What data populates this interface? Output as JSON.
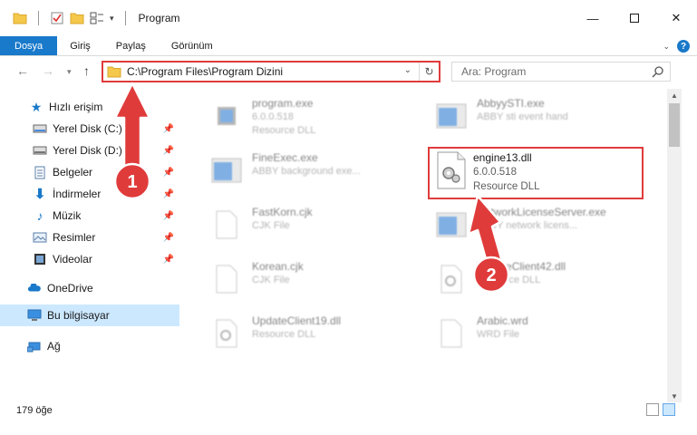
{
  "window": {
    "title": "Program",
    "minimize_icon": "minimize-icon",
    "maximize_icon": "maximize-icon",
    "close_icon": "close-icon"
  },
  "ribbon": {
    "tabs": [
      {
        "label": "Dosya"
      },
      {
        "label": "Giriş"
      },
      {
        "label": "Paylaş"
      },
      {
        "label": "Görünüm"
      }
    ]
  },
  "address": {
    "path": "C:\\Program Files\\Program Dizini"
  },
  "search": {
    "placeholder": "Ara: Program"
  },
  "sidebar": {
    "items": [
      {
        "label": "Hızlı erişim",
        "icon": "star-icon"
      },
      {
        "label": "Yerel Disk (C:)",
        "icon": "drive-icon"
      },
      {
        "label": "Yerel Disk (D:)",
        "icon": "drive-icon"
      },
      {
        "label": "Belgeler",
        "icon": "document-icon"
      },
      {
        "label": "İndirmeler",
        "icon": "download-icon"
      },
      {
        "label": "Müzik",
        "icon": "music-icon"
      },
      {
        "label": "Resimler",
        "icon": "pictures-icon"
      },
      {
        "label": "Videolar",
        "icon": "video-icon"
      },
      {
        "label": "OneDrive",
        "icon": "cloud-icon"
      },
      {
        "label": "Bu bilgisayar",
        "icon": "computer-icon"
      },
      {
        "label": "Ağ",
        "icon": "network-icon"
      }
    ]
  },
  "files": [
    {
      "name": "program.exe",
      "sub": "6.0.0.518"
    },
    {
      "name": "AbbyySTI.exe",
      "sub": "ABBY sti event hand"
    },
    {
      "name": "",
      "sub": "Resource DLL"
    },
    {
      "name": "FineExec.exe",
      "sub": "ABBY background exe..."
    },
    {
      "name": "FastKorn.cjk",
      "sub": "CJK File"
    },
    {
      "name": "NetworkLicenseServer.exe",
      "sub": "ABBY network licens..."
    },
    {
      "name": "Korean.cjk",
      "sub": "CJK File"
    },
    {
      "name": "UpdateClient42.dll",
      "sub": "Resource DLL"
    },
    {
      "name": "UpdateClient19.dll",
      "sub": "Resource DLL"
    },
    {
      "name": "Arabic.wrd",
      "sub": "WRD File"
    }
  ],
  "highlighted_file": {
    "name": "engine13.dll",
    "version": "6.0.0.518",
    "type": "Resource DLL"
  },
  "annotations": {
    "badge1": "1",
    "badge2": "2"
  },
  "status": {
    "count": "179 öğe"
  },
  "colors": {
    "accent": "#1979ca",
    "highlight_red": "#e03b3b",
    "selected_bg": "#cce8ff"
  }
}
